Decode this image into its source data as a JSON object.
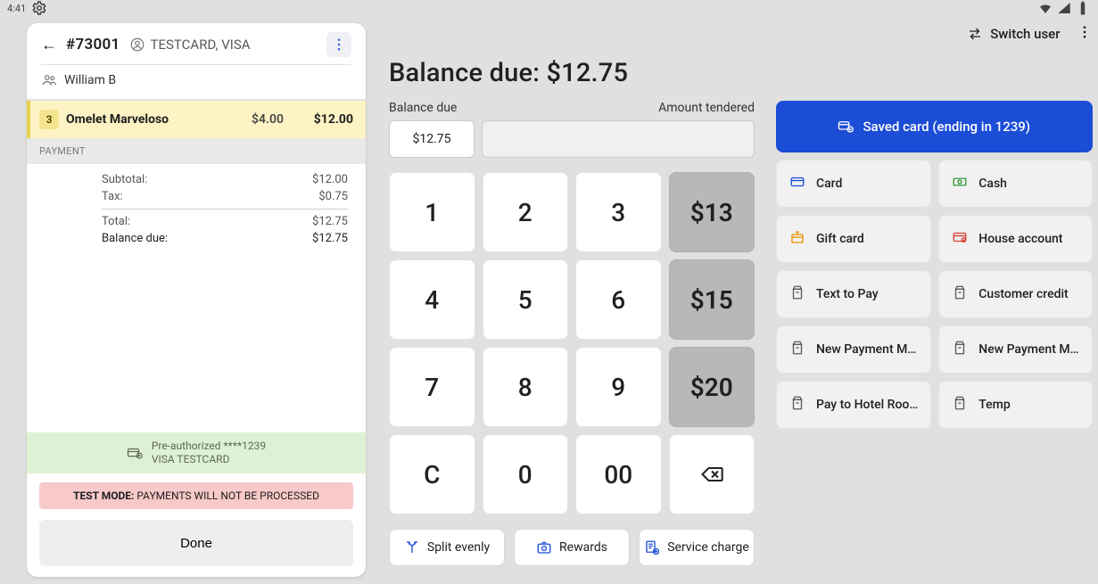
{
  "statusbar": {
    "time": "4:41"
  },
  "order": {
    "number": "#73001",
    "card_label": "TESTCARD, VISA",
    "customer": "William B",
    "item": {
      "qty": "3",
      "name": "Omelet Marveloso",
      "unit": "$4.00",
      "ext": "$12.00"
    },
    "section_label": "PAYMENT",
    "totals": {
      "subtotal_label": "Subtotal:",
      "subtotal": "$12.00",
      "tax_label": "Tax:",
      "tax": "$0.75",
      "total_label": "Total:",
      "total": "$12.75",
      "balance_label": "Balance due:",
      "balance": "$12.75"
    },
    "preauth": {
      "line1": "Pre-authorized ****1239",
      "line2": "VISA TESTCARD"
    },
    "testmode": {
      "bold": "TEST MODE:",
      "rest": "  PAYMENTS WILL NOT BE PROCESSED"
    },
    "done": "Done"
  },
  "topbar": {
    "switch_user": "Switch user"
  },
  "balance": {
    "label": "Balance due: ",
    "amount": "$12.75"
  },
  "pad": {
    "labels": {
      "due": "Balance due",
      "tendered": "Amount tendered"
    },
    "due_chip": "$12.75",
    "keys": [
      "1",
      "2",
      "3",
      "$13",
      "4",
      "5",
      "6",
      "$15",
      "7",
      "8",
      "9",
      "$20",
      "C",
      "0",
      "00",
      "⌫"
    ],
    "quick_flags": [
      false,
      false,
      false,
      true,
      false,
      false,
      false,
      true,
      false,
      false,
      false,
      true,
      false,
      false,
      false,
      false
    ],
    "actions": {
      "split": "Split evenly",
      "rewards": "Rewards",
      "service": "Service charge"
    }
  },
  "methods": {
    "saved": "Saved card (ending in 1239)",
    "list": [
      {
        "label": "Card",
        "color": "blue"
      },
      {
        "label": "Cash",
        "color": "green"
      },
      {
        "label": "Gift card",
        "color": "orange"
      },
      {
        "label": "House account",
        "color": "red"
      },
      {
        "label": "Text to Pay",
        "color": "gray"
      },
      {
        "label": "Customer credit",
        "color": "gray"
      },
      {
        "label": "New Payment M…",
        "color": "gray"
      },
      {
        "label": "New Payment M…",
        "color": "gray"
      },
      {
        "label": "Pay to Hotel Roo…",
        "color": "gray"
      },
      {
        "label": "Temp",
        "color": "gray"
      }
    ]
  }
}
